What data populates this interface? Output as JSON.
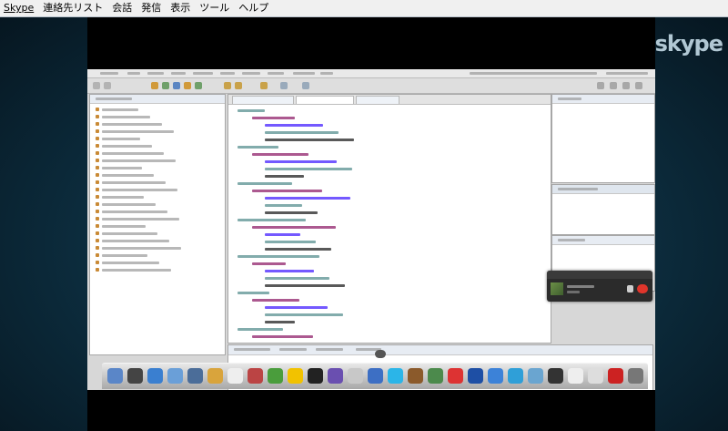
{
  "menubar": {
    "items": [
      "Skype",
      "連絡先リスト",
      "会話",
      "発信",
      "表示",
      "ツール",
      "ヘルプ"
    ]
  },
  "brand": {
    "logo_text": "skype"
  },
  "colors": {
    "frame_accent": "#1d5a78",
    "end_call": "#e0352b",
    "menu_bg": "#f0f0f0"
  }
}
